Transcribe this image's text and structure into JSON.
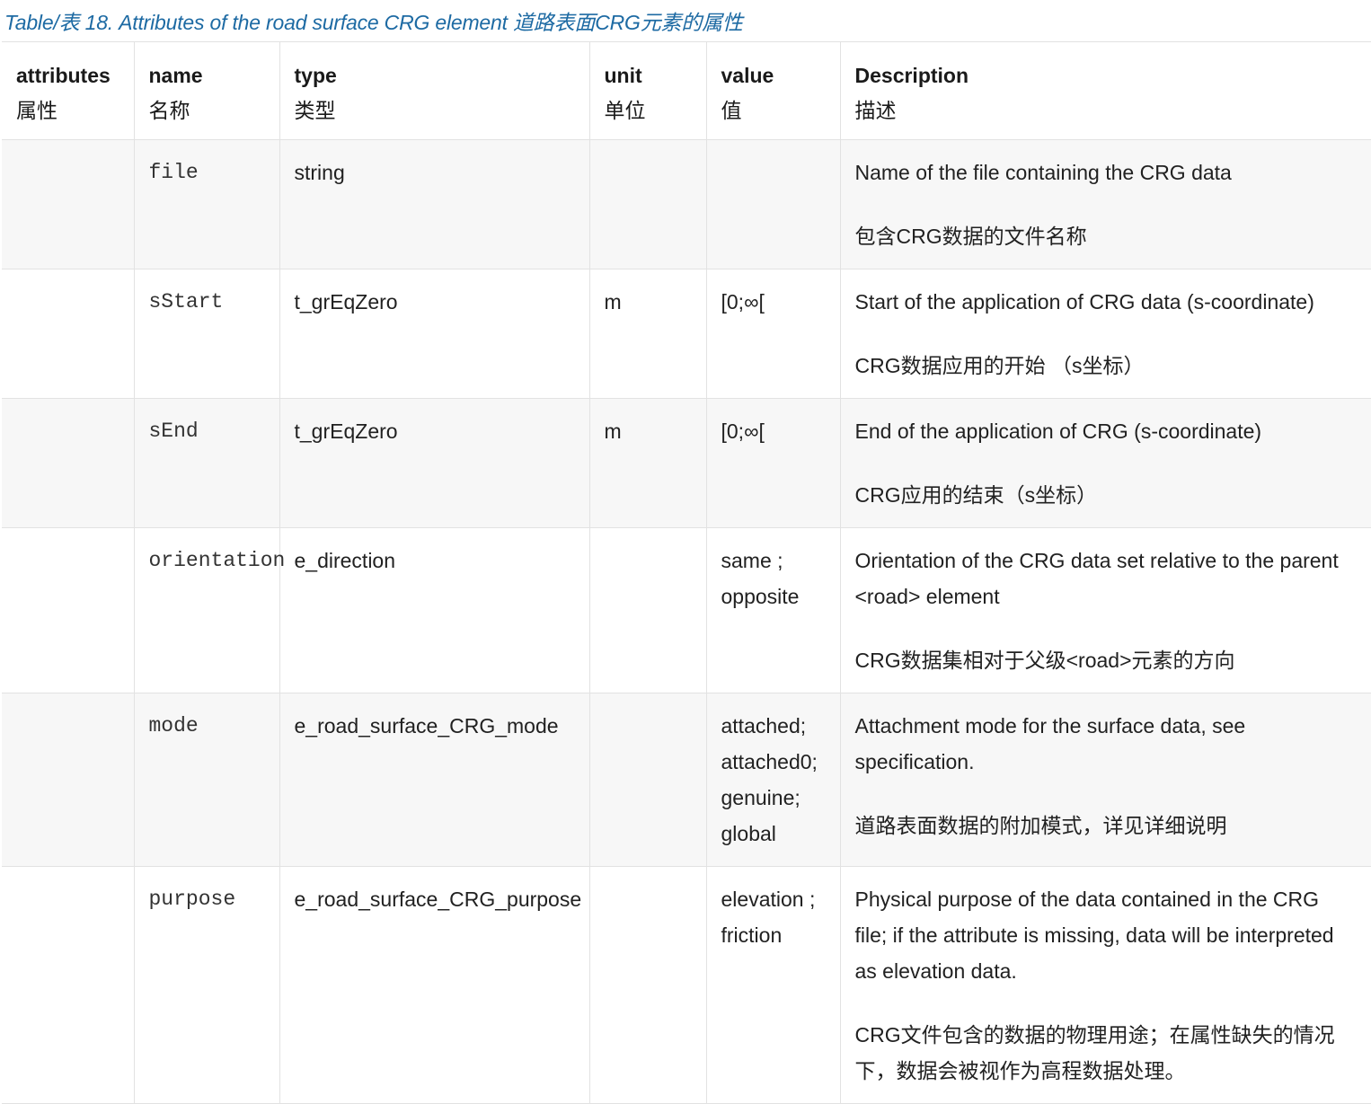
{
  "caption": "Table/表 18. Attributes of the road surface CRG element 道路表面CRG元素的属性",
  "headers": [
    {
      "en": "attributes",
      "cn": "属性"
    },
    {
      "en": "name",
      "cn": "名称"
    },
    {
      "en": "type",
      "cn": "类型"
    },
    {
      "en": "unit",
      "cn": "单位"
    },
    {
      "en": "value",
      "cn": "值"
    },
    {
      "en": "Description",
      "cn": "描述"
    }
  ],
  "rows": [
    {
      "attributes": "",
      "name": "file",
      "type": "string",
      "unit": "",
      "values": [],
      "desc_en": "Name of the file containing the CRG data",
      "desc_cn": "包含CRG数据的文件名称"
    },
    {
      "attributes": "",
      "name": "sStart",
      "type": "t_grEqZero",
      "unit": "m",
      "values": [
        "[0;∞["
      ],
      "desc_en": "Start of the application of CRG data (s-coordinate)",
      "desc_cn": "CRG数据应用的开始 （s坐标）"
    },
    {
      "attributes": "",
      "name": "sEnd",
      "type": "t_grEqZero",
      "unit": "m",
      "values": [
        "[0;∞["
      ],
      "desc_en": "End of the application of CRG (s-coordinate)",
      "desc_cn": "CRG应用的结束（s坐标）"
    },
    {
      "attributes": "",
      "name": "orientation",
      "type": "e_direction",
      "unit": "",
      "values": [
        "same ;",
        "opposite"
      ],
      "desc_en": "Orientation of the CRG data set relative to the parent <road> element",
      "desc_cn": "CRG数据集相对于父级<road>元素的方向"
    },
    {
      "attributes": "",
      "name": "mode",
      "type": "e_road_surface_CRG_mode",
      "unit": "",
      "values": [
        "attached;",
        "attached0;",
        "genuine;",
        "global"
      ],
      "desc_en": "Attachment mode for the surface data, see specification.",
      "desc_cn": "道路表面数据的附加模式，详见详细说明"
    },
    {
      "attributes": "",
      "name": "purpose",
      "type": "e_road_surface_CRG_purpose",
      "unit": "",
      "values": [
        "elevation ;",
        "friction"
      ],
      "desc_en": "Physical purpose of the data contained in the CRG file; if the attribute is missing, data will be interpreted as elevation data.",
      "desc_cn": "CRG文件包含的数据的物理用途；在属性缺失的情况下，数据会被视作为高程数据处理。"
    }
  ]
}
